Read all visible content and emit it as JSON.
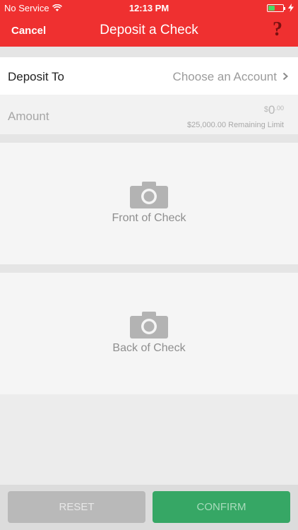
{
  "status_bar": {
    "carrier": "No Service",
    "time": "12:13 PM",
    "battery_level": 0.4,
    "wifi_icon": "wifi-icon",
    "charging_icon": "bolt-icon"
  },
  "nav": {
    "cancel_label": "Cancel",
    "title": "Deposit a Check",
    "help_label": "?"
  },
  "deposit_to": {
    "label": "Deposit To",
    "value": "Choose an Account",
    "icon": "chevron-right-icon"
  },
  "amount": {
    "label": "Amount",
    "currency": "$",
    "value": "0",
    "cents": ".00",
    "remaining_limit": "$25,000.00 Remaining Limit"
  },
  "front_check": {
    "label": "Front of Check",
    "icon": "camera-icon"
  },
  "back_check": {
    "label": "Back of Check",
    "icon": "camera-icon"
  },
  "footer": {
    "reset_label": "RESET",
    "confirm_label": "CONFIRM"
  },
  "colors": {
    "header": "#ef3030",
    "confirm": "#36a765",
    "reset": "#b9b9b9"
  }
}
